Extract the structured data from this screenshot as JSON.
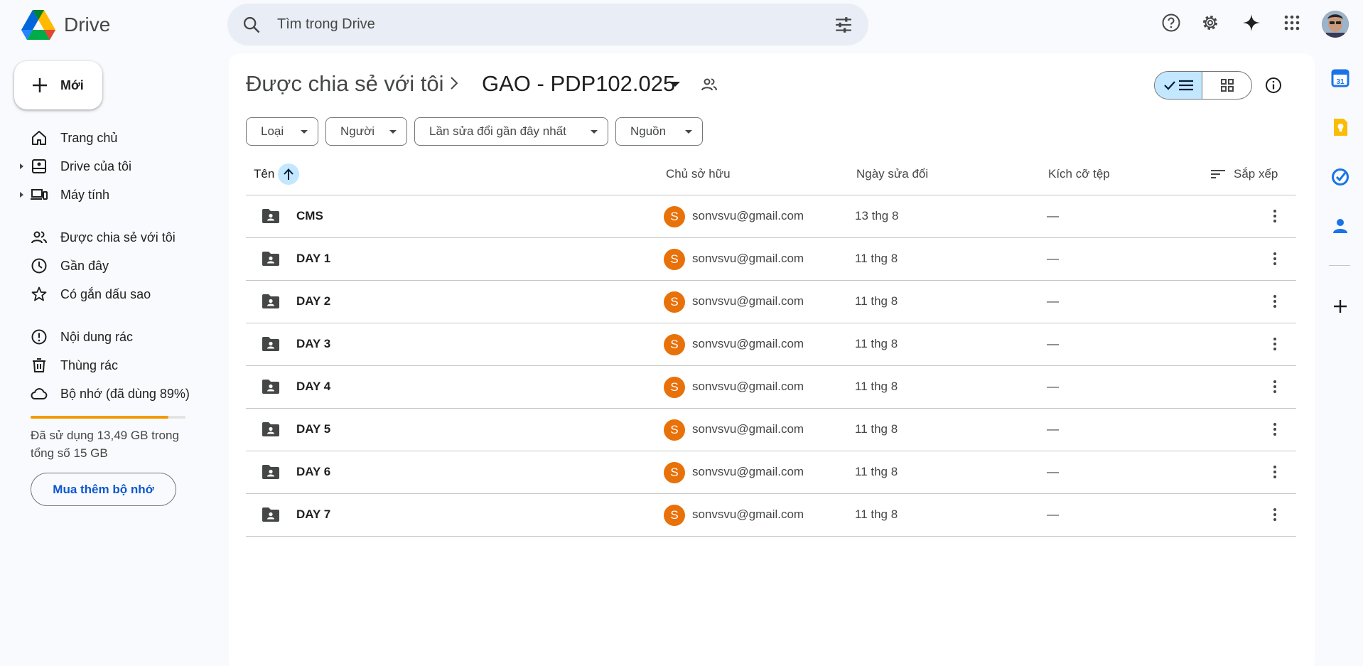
{
  "app": {
    "name": "Drive"
  },
  "search": {
    "placeholder": "Tìm trong Drive"
  },
  "sidebar": {
    "new_label": "Mới",
    "items": [
      {
        "label": "Trang chủ",
        "icon": "home-icon"
      },
      {
        "label": "Drive của tôi",
        "icon": "my-drive-icon"
      },
      {
        "label": "Máy tính",
        "icon": "computer-icon"
      },
      {
        "label": "Được chia sẻ với tôi",
        "icon": "shared-icon"
      },
      {
        "label": "Gần đây",
        "icon": "clock-icon"
      },
      {
        "label": "Có gắn dấu sao",
        "icon": "star-icon"
      },
      {
        "label": "Nội dung rác",
        "icon": "spam-icon"
      },
      {
        "label": "Thùng rác",
        "icon": "trash-icon"
      },
      {
        "label": "Bộ nhớ (đã dùng 89%)",
        "icon": "cloud-icon"
      }
    ],
    "storage": {
      "used_fraction": 0.89,
      "text": "Đã sử dụng 13,49 GB trong tổng số 15 GB",
      "buy_label": "Mua thêm bộ nhớ"
    }
  },
  "breadcrumb": {
    "parent": "Được chia sẻ với tôi",
    "current": "GAO - PDP102.025"
  },
  "filters": [
    "Loại",
    "Người",
    "Lần sửa đổi gần đây nhất",
    "Nguồn"
  ],
  "table": {
    "columns": {
      "name": "Tên",
      "owner": "Chủ sở hữu",
      "modified": "Ngày sửa đổi",
      "size": "Kích cỡ tệp",
      "sort": "Sắp xếp"
    },
    "rows": [
      {
        "name": "CMS",
        "owner_initial": "S",
        "owner": "sonvsvu@gmail.com",
        "modified": "13 thg 8",
        "size": "—"
      },
      {
        "name": "DAY 1",
        "owner_initial": "S",
        "owner": "sonvsvu@gmail.com",
        "modified": "11 thg 8",
        "size": "—"
      },
      {
        "name": "DAY 2",
        "owner_initial": "S",
        "owner": "sonvsvu@gmail.com",
        "modified": "11 thg 8",
        "size": "—"
      },
      {
        "name": "DAY 3",
        "owner_initial": "S",
        "owner": "sonvsvu@gmail.com",
        "modified": "11 thg 8",
        "size": "—"
      },
      {
        "name": "DAY 4",
        "owner_initial": "S",
        "owner": "sonvsvu@gmail.com",
        "modified": "11 thg 8",
        "size": "—"
      },
      {
        "name": "DAY 5",
        "owner_initial": "S",
        "owner": "sonvsvu@gmail.com",
        "modified": "11 thg 8",
        "size": "—"
      },
      {
        "name": "DAY 6",
        "owner_initial": "S",
        "owner": "sonvsvu@gmail.com",
        "modified": "11 thg 8",
        "size": "—"
      },
      {
        "name": "DAY 7",
        "owner_initial": "S",
        "owner": "sonvsvu@gmail.com",
        "modified": "11 thg 8",
        "size": "—"
      }
    ]
  },
  "colors": {
    "accent": "#0b57d0",
    "selected": "#c2e7ff",
    "storage_fill": "#f29900",
    "owner_avatar": "#e8710a"
  }
}
